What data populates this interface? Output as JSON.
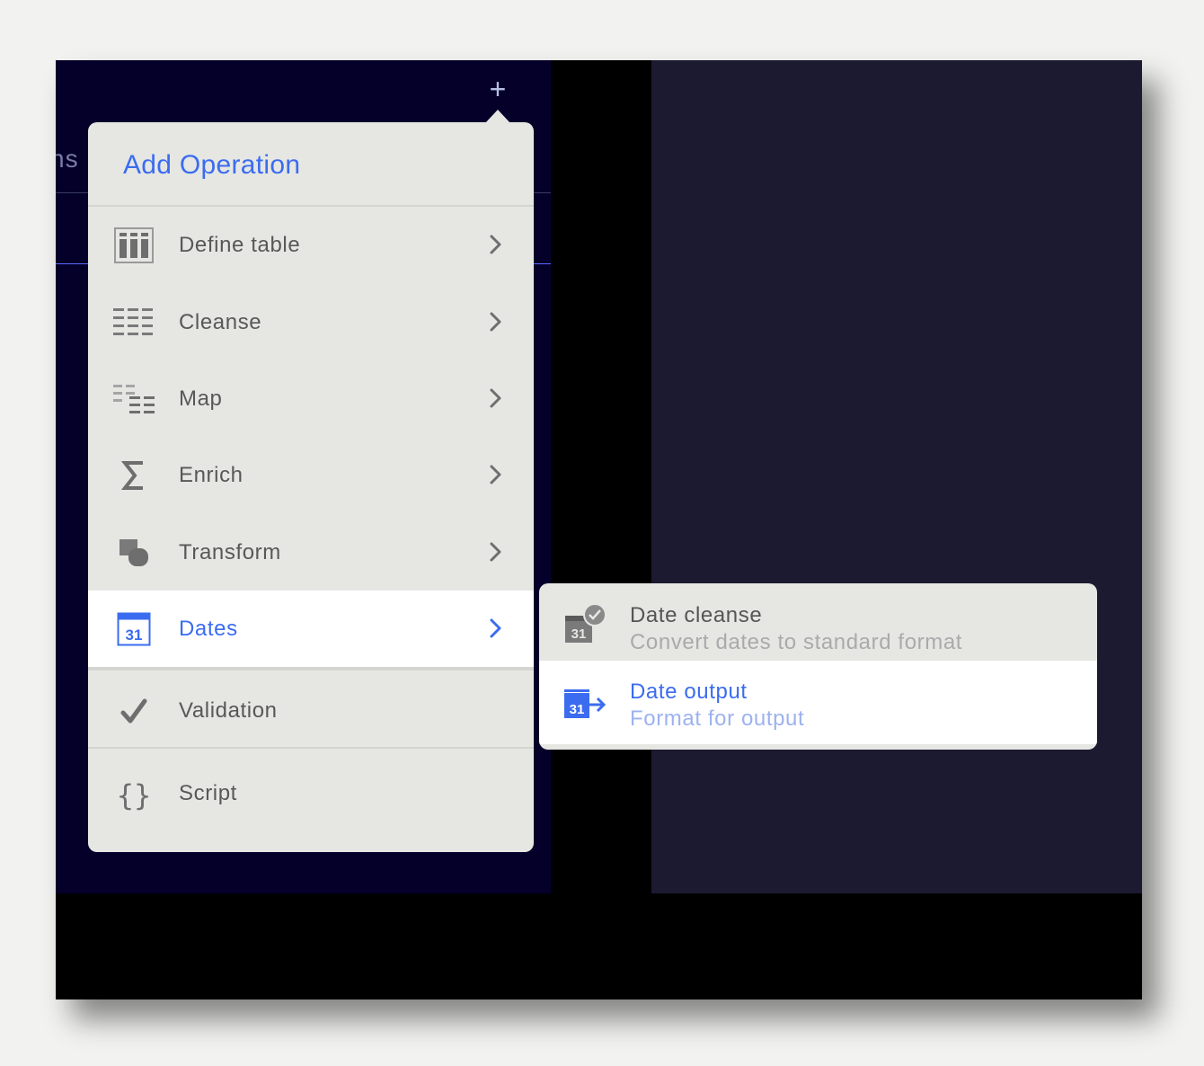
{
  "window": {
    "tab_fragment": "ns",
    "add_button_symbol": "+"
  },
  "popover": {
    "title": "Add Operation",
    "items": [
      {
        "label": "Define table",
        "icon": "table-columns-icon",
        "has_submenu": true
      },
      {
        "label": "Cleanse",
        "icon": "cleanse-rows-icon",
        "has_submenu": true
      },
      {
        "label": "Map",
        "icon": "map-rows-icon",
        "has_submenu": true
      },
      {
        "label": "Enrich",
        "icon": "sigma-icon",
        "has_submenu": true
      },
      {
        "label": "Transform",
        "icon": "transform-shapes-icon",
        "has_submenu": true
      },
      {
        "label": "Dates",
        "icon": "calendar-icon",
        "has_submenu": true,
        "active": true
      },
      {
        "label": "Validation",
        "icon": "checkmark-icon",
        "has_submenu": false
      },
      {
        "label": "Script",
        "icon": "curly-braces-icon",
        "has_submenu": false
      }
    ]
  },
  "submenu": {
    "items": [
      {
        "title": "Date cleanse",
        "description": "Convert dates to standard format",
        "icon": "calendar-check-icon"
      },
      {
        "title": "Date output",
        "description": "Format for output",
        "icon": "calendar-arrow-icon",
        "active": true
      }
    ]
  },
  "colors": {
    "accent": "#3b6cf0",
    "menu_bg": "#e6e7e3",
    "left_panel_bg": "#04002a",
    "right_panel_bg": "#1c1a31",
    "text_gray": "#585858"
  },
  "calendar_day": "31"
}
